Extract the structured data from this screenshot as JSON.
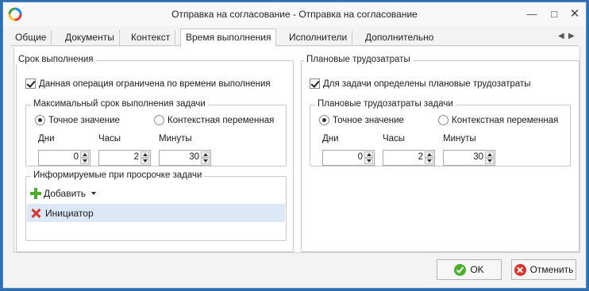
{
  "window": {
    "title": "Отправка на согласование - Отправка на согласование"
  },
  "tabs": [
    {
      "label": "Общие"
    },
    {
      "label": "Документы"
    },
    {
      "label": "Контекст"
    },
    {
      "label": "Время выполнения",
      "active": true
    },
    {
      "label": "Исполнители"
    },
    {
      "label": "Дополнительно"
    }
  ],
  "left": {
    "group_title": "Срок выполнения",
    "limit_checkbox": {
      "label": "Данная операция ограничена по времени выполнения",
      "checked": true
    },
    "max_term": {
      "title": "Максимальный срок выполнения задачи",
      "radio_exact": {
        "label": "Точное значение",
        "selected": true
      },
      "radio_context": {
        "label": "Контекстная переменная",
        "selected": false
      },
      "days": {
        "label": "Дни",
        "value": "0"
      },
      "hours": {
        "label": "Часы",
        "value": "2"
      },
      "minutes": {
        "label": "Минуты",
        "value": "30"
      }
    },
    "informed": {
      "title": "Информируемые при просрочке задачи",
      "add_label": "Добавить",
      "items": [
        "Инициатор"
      ]
    }
  },
  "right": {
    "group_title": "Плановые трудозатраты",
    "planned_checkbox": {
      "label": "Для задачи определены плановые трудозатраты",
      "checked": true
    },
    "effort": {
      "title": "Плановые трудозатраты задачи",
      "radio_exact": {
        "label": "Точное значение",
        "selected": true
      },
      "radio_context": {
        "label": "Контекстная переменная",
        "selected": false
      },
      "days": {
        "label": "Дни",
        "value": "0"
      },
      "hours": {
        "label": "Часы",
        "value": "2"
      },
      "minutes": {
        "label": "Минуты",
        "value": "30"
      }
    }
  },
  "buttons": {
    "ok": "OK",
    "cancel": "Отменить"
  },
  "colors": {
    "accent_blue": "#2f6fb0",
    "selection": "#dde8f7",
    "add_green": "#4caf2f",
    "remove_red": "#d8342c"
  }
}
